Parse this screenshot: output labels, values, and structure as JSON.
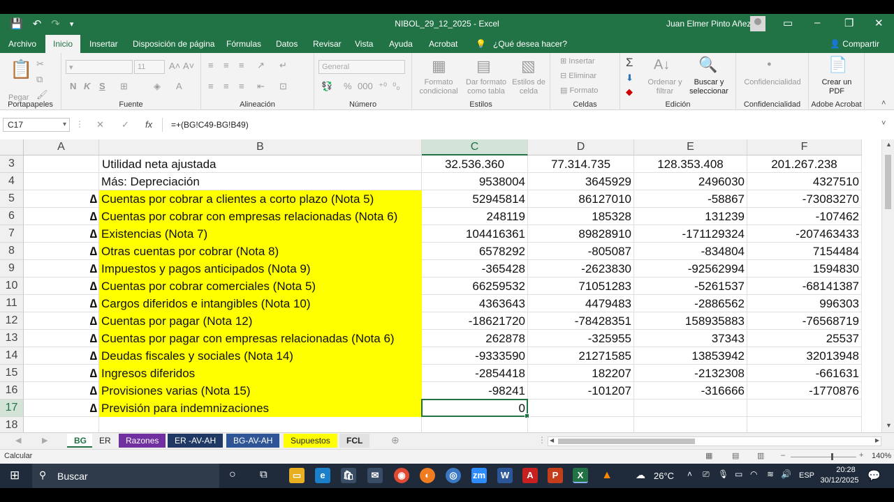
{
  "titlebar": {
    "doc_title": "NIBOL_29_12_2025  -  Excel",
    "user": "Juan Elmer Pinto Añez"
  },
  "tabs": [
    "Archivo",
    "Inicio",
    "Insertar",
    "Disposición de página",
    "Fórmulas",
    "Datos",
    "Revisar",
    "Vista",
    "Ayuda",
    "Acrobat"
  ],
  "tell_me": "¿Qué desea hacer?",
  "share": "Compartir",
  "ribbon": {
    "groups": [
      "Portapapeles",
      "Fuente",
      "Alineación",
      "Número",
      "Estilos",
      "Celdas",
      "Edición",
      "Confidencialidad",
      "Adobe Acrobat"
    ],
    "paste": "Pegar",
    "font_size": "11",
    "number_format": "General",
    "format_cond": "Formato condicional",
    "format_table": "Dar formato como tabla",
    "cell_styles": "Estilos de celda",
    "insert": "Insertar",
    "delete": "Eliminar",
    "format": "Formato",
    "sort": "Ordenar y filtrar",
    "find": "Buscar y seleccionar",
    "confid": "Confidencialidad",
    "pdf": "Crear un PDF",
    "bold": "N",
    "italic": "K",
    "underline": "S"
  },
  "formula_bar": {
    "name_box": "C17",
    "fx": "fx",
    "formula": "=+(BG!C49-BG!B49)"
  },
  "columns": [
    "A",
    "B",
    "C",
    "D",
    "E",
    "F"
  ],
  "rows": [
    {
      "n": "3",
      "delta": "",
      "label": "Utilidad neta ajustada",
      "c": "32.536.360",
      "d": "77.314.735",
      "e": "128.353.408",
      "f": "201.267.238"
    },
    {
      "n": "4",
      "delta": "",
      "label": "Más: Depreciación",
      "c": "9538004",
      "d": "3645929",
      "e": "2496030",
      "f": "4327510"
    },
    {
      "n": "5",
      "delta": "∆",
      "label": "Cuentas por cobrar a clientes a corto plazo (Nota 5)",
      "c": "52945814",
      "d": "86127010",
      "e": "-58867",
      "f": "-73083270"
    },
    {
      "n": "6",
      "delta": "∆",
      "label": "Cuentas por cobrar con empresas relacionadas (Nota 6)",
      "c": "248119",
      "d": "185328",
      "e": "131239",
      "f": "-107462"
    },
    {
      "n": "7",
      "delta": "∆",
      "label": "Existencias (Nota 7)",
      "c": "104416361",
      "d": "89828910",
      "e": "-171129324",
      "f": "-207463433"
    },
    {
      "n": "8",
      "delta": "∆",
      "label": "Otras cuentas por cobrar (Nota 8)",
      "c": "6578292",
      "d": "-805087",
      "e": "-834804",
      "f": "7154484"
    },
    {
      "n": "9",
      "delta": "∆",
      "label": "Impuestos y pagos anticipados (Nota 9)",
      "c": "-365428",
      "d": "-2623830",
      "e": "-92562994",
      "f": "1594830"
    },
    {
      "n": "10",
      "delta": "∆",
      "label": "Cuentas por cobrar comerciales (Nota 5)",
      "c": "66259532",
      "d": "71051283",
      "e": "-5261537",
      "f": "-68141387"
    },
    {
      "n": "11",
      "delta": "∆",
      "label": "Cargos diferidos e intangibles (Nota 10)",
      "c": "4363643",
      "d": "4479483",
      "e": "-2886562",
      "f": "996303"
    },
    {
      "n": "12",
      "delta": "∆",
      "label": "Cuentas por pagar (Nota 12)",
      "c": "-18621720",
      "d": "-78428351",
      "e": "158935883",
      "f": "-76568719"
    },
    {
      "n": "13",
      "delta": "∆",
      "label": "Cuentas por pagar con empresas relacionadas (Nota 6)",
      "c": "262878",
      "d": "-325955",
      "e": "37343",
      "f": "25537"
    },
    {
      "n": "14",
      "delta": "∆",
      "label": "Deudas fiscales y sociales (Nota 14)",
      "c": "-9333590",
      "d": "21271585",
      "e": "13853942",
      "f": "32013948"
    },
    {
      "n": "15",
      "delta": "∆",
      "label": "Ingresos diferidos",
      "c": "-2854418",
      "d": "182207",
      "e": "-2132308",
      "f": "-661631"
    },
    {
      "n": "16",
      "delta": "∆",
      "label": "Provisiones varias (Nota 15)",
      "c": "-98241",
      "d": "-101207",
      "e": "-316666",
      "f": "-1770876"
    },
    {
      "n": "17",
      "delta": "∆",
      "label": "Previsión para indemnizaciones",
      "c": "0",
      "d": "",
      "e": "",
      "f": ""
    },
    {
      "n": "18",
      "delta": "",
      "label": "",
      "c": "",
      "d": "",
      "e": "",
      "f": ""
    }
  ],
  "sheets": [
    {
      "name": "BG",
      "color": "#ffffff",
      "text": "#217346"
    },
    {
      "name": "ER",
      "color": "#f0f0f0",
      "text": "#222222"
    },
    {
      "name": "Razones",
      "color": "#7030a0",
      "text": "#ffffff"
    },
    {
      "name": "ER -AV-AH",
      "color": "#1f3864",
      "text": "#ffffff"
    },
    {
      "name": "BG-AV-AH",
      "color": "#2f5597",
      "text": "#ffffff"
    },
    {
      "name": "Supuestos",
      "color": "#ffff00",
      "text": "#222222"
    },
    {
      "name": "FCL",
      "color": "#e2e2e2",
      "text": "#222222"
    }
  ],
  "status": {
    "mode": "Calcular",
    "zoom": "140%"
  },
  "taskbar": {
    "search": "Buscar",
    "weather": "26°C",
    "lang": "ESP",
    "time": "20:28",
    "date": "30/12/2025"
  },
  "colors": {
    "excel_green": "#217346",
    "highlight": "#ffff00"
  }
}
